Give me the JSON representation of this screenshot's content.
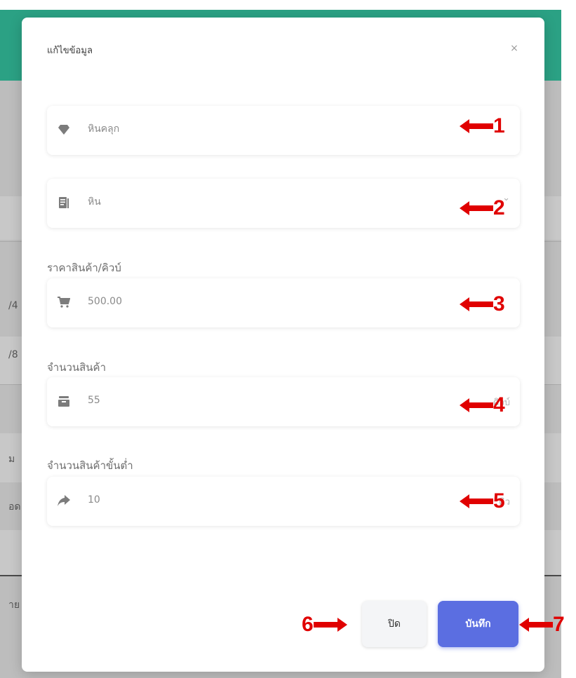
{
  "background": {
    "row_texts": [
      "/4",
      "/8",
      "ม",
      "อด",
      "าย"
    ]
  },
  "modal": {
    "title": "แก้ไขข้อมูล",
    "close_symbol": "×",
    "fields": [
      {
        "icon": "gem-icon",
        "value": "หินคลุก",
        "label": "",
        "suffix": ""
      },
      {
        "icon": "document-list-icon",
        "value": "หิน",
        "label": "",
        "suffix": ""
      },
      {
        "icon": "cart-icon",
        "value": "500.00",
        "label": "ราคาสินค้า/คิวบ์",
        "suffix": ""
      },
      {
        "icon": "box-icon",
        "value": "55",
        "label": "จำนวนสินค้า",
        "suffix": "คิวบ์"
      },
      {
        "icon": "share-arrow-icon",
        "value": "10",
        "label": "จำนวนสินค้าขั้นต่ำ",
        "suffix": "คิว"
      }
    ],
    "buttons": {
      "close_label": "ปิด",
      "save_label": "บันทึก"
    }
  },
  "annotations": [
    "1",
    "2",
    "3",
    "4",
    "5",
    "6",
    "7"
  ],
  "colors": {
    "header_green": "#2ba184",
    "save_blue": "#5b6ee1",
    "annotation_red": "#e00000"
  }
}
